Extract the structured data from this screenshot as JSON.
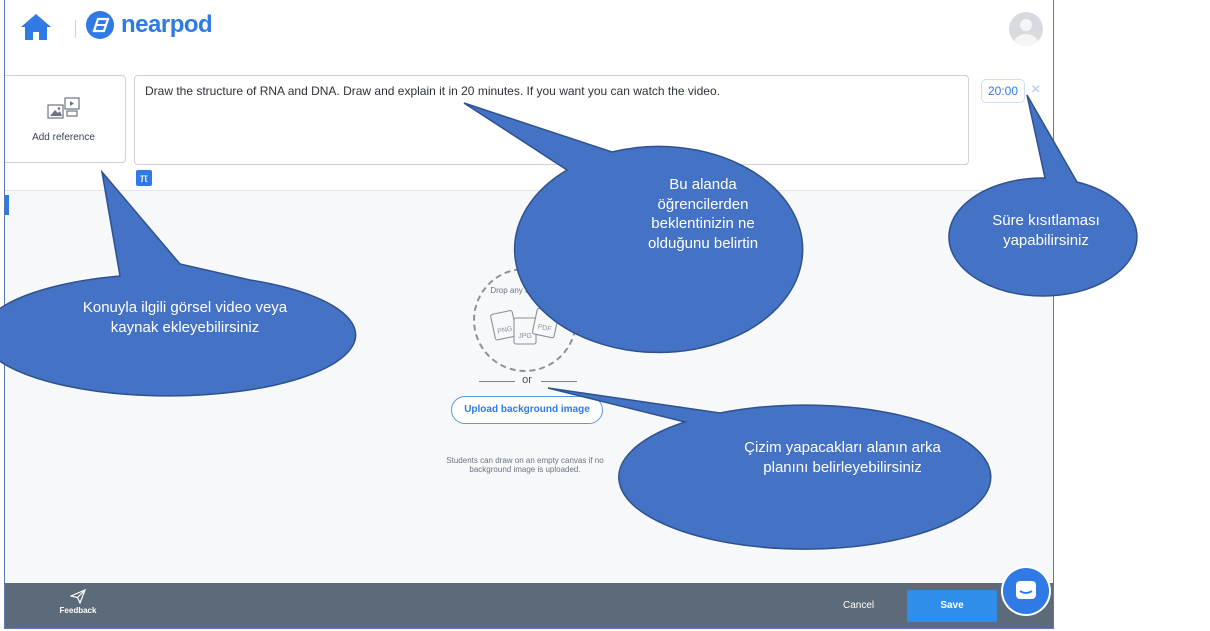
{
  "app": {
    "name": "nearpod"
  },
  "editor": {
    "add_reference_label": "Add reference",
    "prompt_text": "Draw the structure of RNA and DNA. Draw and explain it in 20 minutes. If you want you can watch the video.",
    "math_button_label": "π",
    "timer_value": "20:00",
    "timer_close_label": "×"
  },
  "canvas": {
    "drop_text": "Drop any files here!",
    "file_types": [
      "PNG",
      "JPG",
      "PDF"
    ],
    "or_label": "or",
    "upload_label": "Upload background image",
    "hint_text": "Students can draw on an empty canvas if no background image is uploaded."
  },
  "footer": {
    "feedback_label": "Feedback",
    "cancel_label": "Cancel",
    "save_label": "Save"
  },
  "callouts": {
    "reference": "Konuyla ilgili görsel video veya kaynak ekleyebilirsiniz",
    "prompt": "Bu alanda öğrencilerden beklentinizin ne olduğunu belirtin",
    "timer": "Süre kısıtlaması yapabilirsiniz",
    "background": "Çizim yapacakları alanın arka planını belirleyebilirsiniz"
  },
  "colors": {
    "accent": "#2f7ae5",
    "callout_fill": "#4472c4",
    "footer": "#5c6a79"
  }
}
